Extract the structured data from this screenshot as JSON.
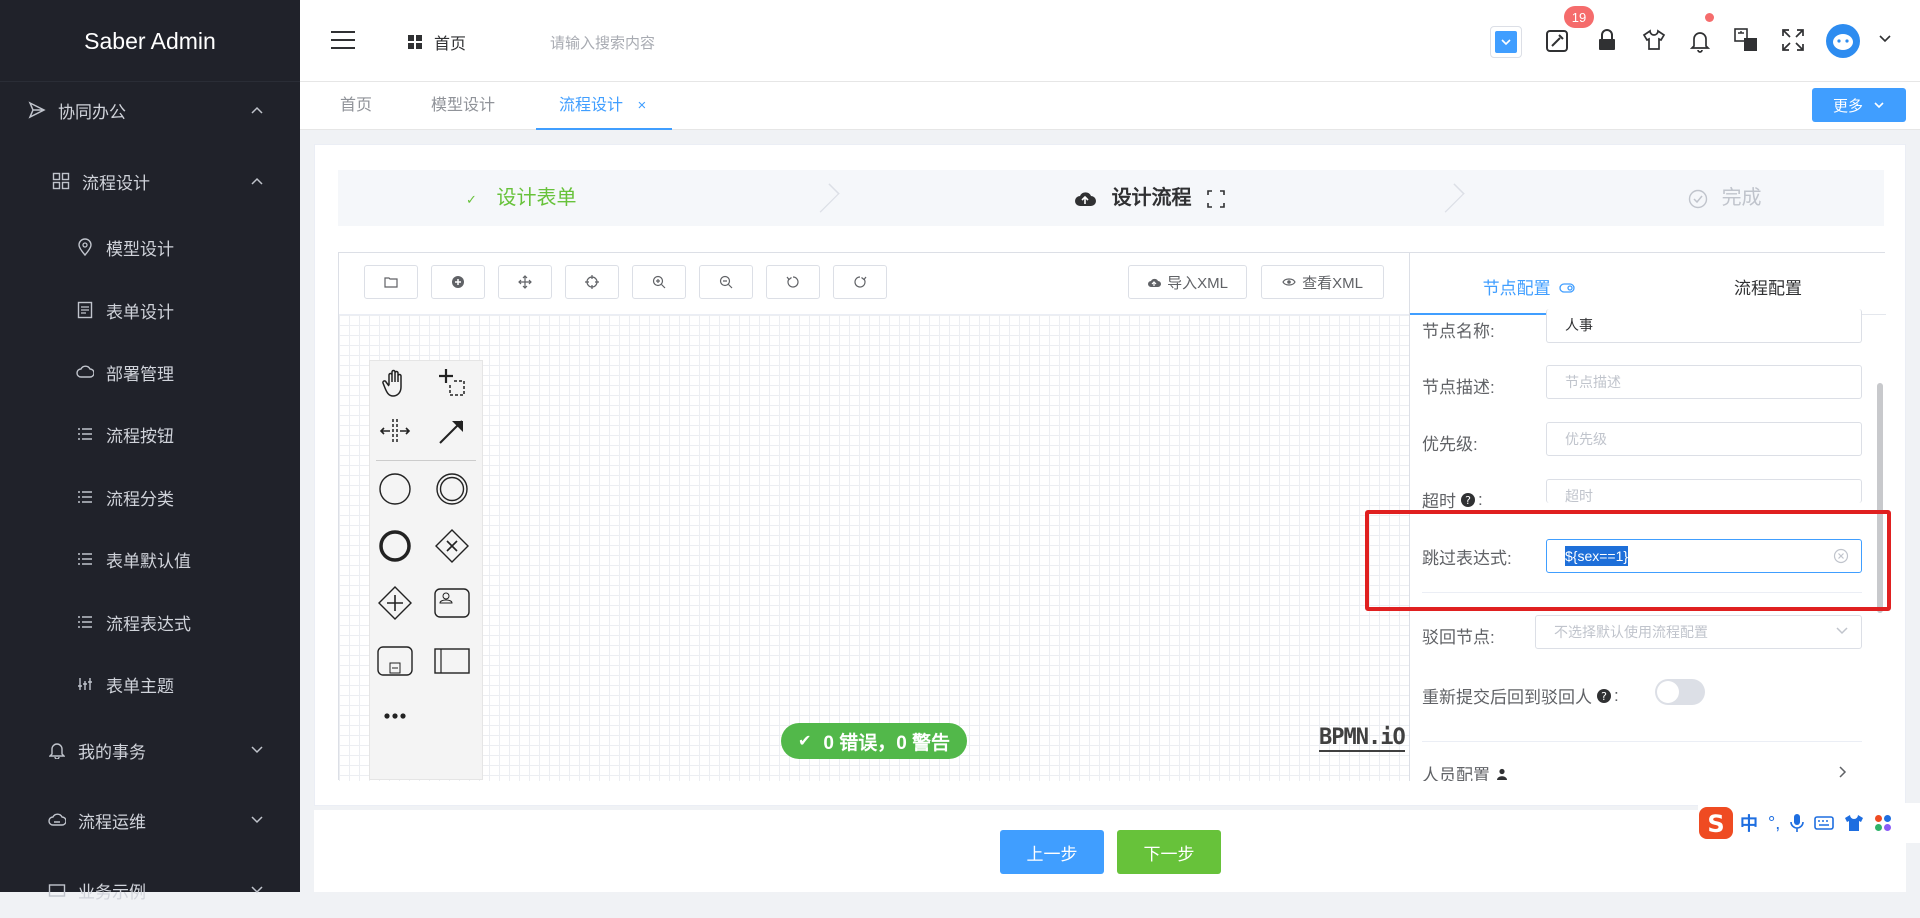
{
  "app": {
    "title": "Saber Admin"
  },
  "sidebar": {
    "items": [
      {
        "label": "协同办公",
        "icon": "send-icon"
      },
      {
        "label": "流程设计",
        "icon": "grid-icon"
      },
      {
        "label": "模型设计",
        "icon": "location-icon"
      },
      {
        "label": "表单设计",
        "icon": "document-icon"
      },
      {
        "label": "部署管理",
        "icon": "cloud-icon"
      },
      {
        "label": "流程按钮",
        "icon": "list-icon"
      },
      {
        "label": "流程分类",
        "icon": "list-icon"
      },
      {
        "label": "表单默认值",
        "icon": "list-icon"
      },
      {
        "label": "流程表达式",
        "icon": "list-icon"
      },
      {
        "label": "表单主题",
        "icon": "theme-icon"
      },
      {
        "label": "我的事务",
        "icon": "bell-icon"
      },
      {
        "label": "流程运维",
        "icon": "ops-icon"
      },
      {
        "label": "业务示例",
        "icon": "example-icon"
      }
    ]
  },
  "header": {
    "home_label": "首页",
    "search_placeholder": "请输入搜索内容",
    "badge_count": "19"
  },
  "tabs": {
    "items": [
      "首页",
      "模型设计",
      "流程设计"
    ],
    "close_symbol": "×",
    "more_label": "更多"
  },
  "steps": {
    "step1": "设计表单",
    "step2": "设计流程",
    "step3": "完成"
  },
  "toolbar": {
    "import_xml": "导入XML",
    "view_xml": "查看XML"
  },
  "canvas": {
    "status_text": "0 错误，0 警告",
    "logo_text": "BPMN.iO"
  },
  "panel": {
    "tab_node": "节点配置",
    "tab_process": "流程配置",
    "fields": {
      "node_name_label": "节点名称:",
      "node_name_value": "人事",
      "node_desc_label": "节点描述:",
      "node_desc_placeholder": "节点描述",
      "priority_label": "优先级:",
      "priority_placeholder": "优先级",
      "timeout_label": "超时",
      "timeout_colon": ":",
      "timeout_placeholder": "超时",
      "skip_expr_label": "跳过表达式:",
      "skip_expr_value": "${sex==1}",
      "reject_label": "驳回节点:",
      "reject_placeholder": "不选择默认使用流程配置",
      "resubmit_label": "重新提交后回到驳回人",
      "resubmit_colon": ":",
      "personnel_label": "人员配置"
    }
  },
  "footer": {
    "prev_label": "上一步",
    "next_label": "下一步"
  },
  "ime": {
    "lang_label": "中",
    "punct_label": "°,"
  },
  "colors": {
    "primary": "#409eff",
    "success": "#67c23a",
    "sidebar_bg": "#20222a",
    "highlight_red": "#e02020"
  }
}
